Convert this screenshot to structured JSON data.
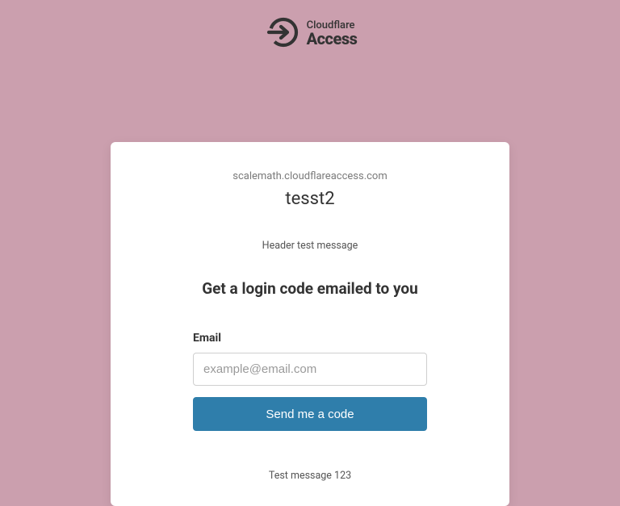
{
  "logo": {
    "top_text": "Cloudflare",
    "bottom_text": "Access"
  },
  "card": {
    "domain": "scalemath.cloudflareaccess.com",
    "app_title": "tesst2",
    "header_message": "Header test message",
    "headline": "Get a login code emailed to you",
    "email_label": "Email",
    "email_placeholder": "example@email.com",
    "submit_label": "Send me a code",
    "footer_message": "Test message 123"
  }
}
